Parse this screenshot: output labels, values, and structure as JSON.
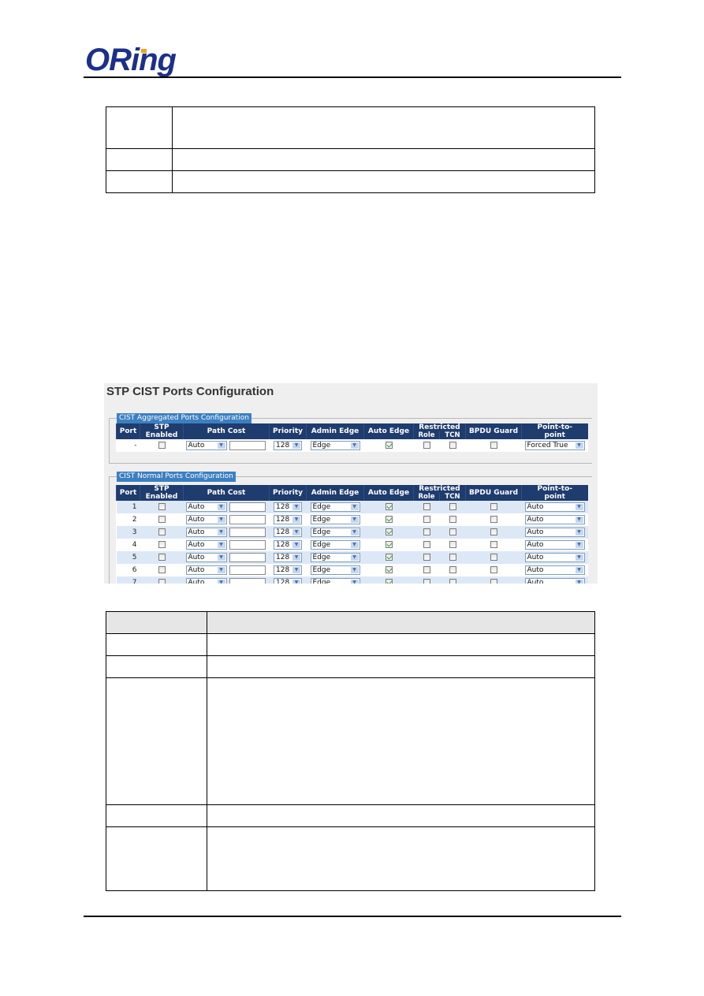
{
  "header": {
    "logo_text_o": "O",
    "logo_text_rest": "Ring",
    "logo_color": "#1c2f8a",
    "logo_accent_color": "#f2a21d"
  },
  "top_table": {
    "rows": [
      {
        "col1": "",
        "col2": ""
      },
      {
        "col1": "",
        "col2": ""
      },
      {
        "col1": "",
        "col2": ""
      }
    ]
  },
  "screenshot": {
    "title": "STP CIST Ports Configuration",
    "header_color": "#1f3c6e",
    "legend_color": "#3c7fc1",
    "columns": {
      "port": "Port",
      "stp_enabled_1": "STP",
      "stp_enabled_2": "Enabled",
      "path_cost": "Path Cost",
      "priority": "Priority",
      "admin_edge": "Admin Edge",
      "auto_edge": "Auto Edge",
      "restricted": "Restricted",
      "role": "Role",
      "tcn": "TCN",
      "bpdu_guard": "BPDU Guard",
      "p2p_1": "Point-to-",
      "p2p_2": "point"
    },
    "aggregated": {
      "legend": "CIST Aggregated Ports Configuration",
      "row": {
        "port": "-",
        "stp_enabled": false,
        "path_cost": "Auto",
        "path_cost_value": "",
        "priority": "128",
        "admin_edge": "Edge",
        "auto_edge": true,
        "restricted_role": false,
        "restricted_tcn": false,
        "bpdu_guard": false,
        "point_to_point": "Forced True"
      }
    },
    "normal": {
      "legend": "CIST Normal Ports Configuration",
      "rows": [
        {
          "port": "1",
          "stp_enabled": false,
          "path_cost": "Auto",
          "path_cost_value": "",
          "priority": "128",
          "admin_edge": "Edge",
          "auto_edge": true,
          "restricted_role": false,
          "restricted_tcn": false,
          "bpdu_guard": false,
          "point_to_point": "Auto"
        },
        {
          "port": "2",
          "stp_enabled": false,
          "path_cost": "Auto",
          "path_cost_value": "",
          "priority": "128",
          "admin_edge": "Edge",
          "auto_edge": true,
          "restricted_role": false,
          "restricted_tcn": false,
          "bpdu_guard": false,
          "point_to_point": "Auto"
        },
        {
          "port": "3",
          "stp_enabled": false,
          "path_cost": "Auto",
          "path_cost_value": "",
          "priority": "128",
          "admin_edge": "Edge",
          "auto_edge": true,
          "restricted_role": false,
          "restricted_tcn": false,
          "bpdu_guard": false,
          "point_to_point": "Auto"
        },
        {
          "port": "4",
          "stp_enabled": false,
          "path_cost": "Auto",
          "path_cost_value": "",
          "priority": "128",
          "admin_edge": "Edge",
          "auto_edge": true,
          "restricted_role": false,
          "restricted_tcn": false,
          "bpdu_guard": false,
          "point_to_point": "Auto"
        },
        {
          "port": "5",
          "stp_enabled": false,
          "path_cost": "Auto",
          "path_cost_value": "",
          "priority": "128",
          "admin_edge": "Edge",
          "auto_edge": true,
          "restricted_role": false,
          "restricted_tcn": false,
          "bpdu_guard": false,
          "point_to_point": "Auto"
        },
        {
          "port": "6",
          "stp_enabled": false,
          "path_cost": "Auto",
          "path_cost_value": "",
          "priority": "128",
          "admin_edge": "Edge",
          "auto_edge": true,
          "restricted_role": false,
          "restricted_tcn": false,
          "bpdu_guard": false,
          "point_to_point": "Auto"
        },
        {
          "port": "7",
          "stp_enabled": false,
          "path_cost": "Auto",
          "path_cost_value": "",
          "priority": "128",
          "admin_edge": "Edge",
          "auto_edge": true,
          "restricted_role": false,
          "restricted_tcn": false,
          "bpdu_guard": false,
          "point_to_point": "Auto"
        }
      ]
    }
  },
  "bottom_table": {
    "header": {
      "col1": "",
      "col2": ""
    },
    "rows": [
      {
        "col1": "",
        "col2": ""
      },
      {
        "col1": "",
        "col2": ""
      },
      {
        "col1": "",
        "col2": ""
      },
      {
        "col1": "",
        "col2": ""
      },
      {
        "col1": "",
        "col2": ""
      }
    ]
  }
}
